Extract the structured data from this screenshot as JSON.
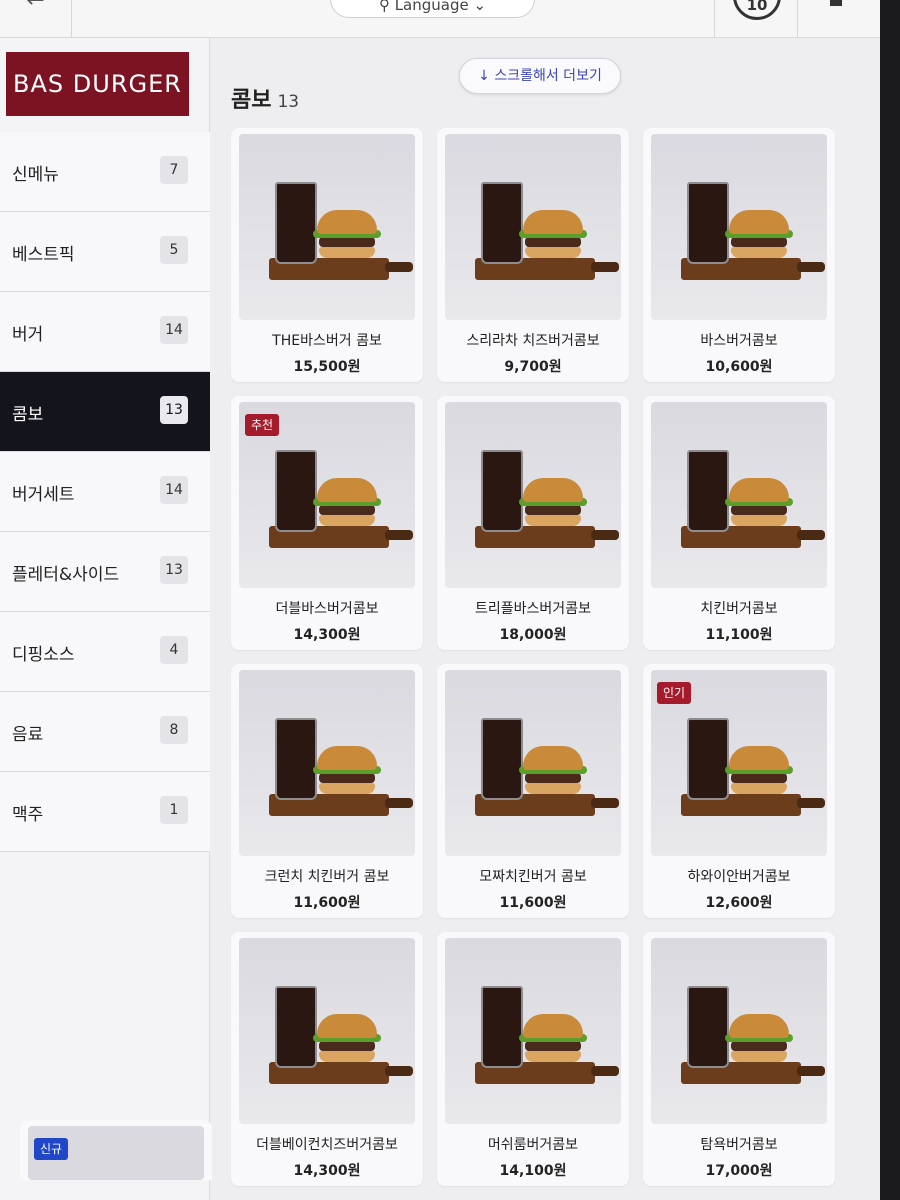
{
  "topbar": {
    "back_label": "←",
    "language_label": "⚲ Language ⌄",
    "timer_value": "10"
  },
  "brand": {
    "logo_text": "BAS DURGER",
    "color": "#7b1322"
  },
  "sidebar": {
    "categories": [
      {
        "label": "신메뉴",
        "count": "7"
      },
      {
        "label": "베스트픽",
        "count": "5"
      },
      {
        "label": "버거",
        "count": "14"
      },
      {
        "label": "콤보",
        "count": "13"
      },
      {
        "label": "버거세트",
        "count": "14"
      },
      {
        "label": "플레터&사이드",
        "count": "13"
      },
      {
        "label": "디핑소스",
        "count": "4"
      },
      {
        "label": "음료",
        "count": "8"
      },
      {
        "label": "맥주",
        "count": "1"
      }
    ],
    "active_index": 3
  },
  "main": {
    "scroll_hint": "↓ 스크롤해서 더보기",
    "section_title": "콤보",
    "section_count": "13",
    "items": [
      {
        "name": "THE바스버거 콤보",
        "price": "15,500원",
        "badge": ""
      },
      {
        "name": "스리라차 치즈버거콤보",
        "price": "9,700원",
        "badge": ""
      },
      {
        "name": "바스버거콤보",
        "price": "10,600원",
        "badge": ""
      },
      {
        "name": "더블바스버거콤보",
        "price": "14,300원",
        "badge": "추천"
      },
      {
        "name": "트리플바스버거콤보",
        "price": "18,000원",
        "badge": ""
      },
      {
        "name": "치킨버거콤보",
        "price": "11,100원",
        "badge": ""
      },
      {
        "name": "크런치 치킨버거 콤보",
        "price": "11,600원",
        "badge": ""
      },
      {
        "name": "모짜치킨버거 콤보",
        "price": "11,600원",
        "badge": ""
      },
      {
        "name": "하와이안버거콤보",
        "price": "12,600원",
        "badge": "인기"
      },
      {
        "name": "더블베이컨치즈버거콤보",
        "price": "14,300원",
        "badge": ""
      },
      {
        "name": "머쉬룸버거콤보",
        "price": "14,100원",
        "badge": ""
      },
      {
        "name": "탐욕버거콤보",
        "price": "17,000원",
        "badge": ""
      }
    ],
    "partial_badge": "신규"
  },
  "colors": {
    "active_category_bg": "#14141c",
    "badge_red": "#a51b2c",
    "badge_blue": "#1f47c7",
    "scroll_hint_text": "#3d47b4"
  }
}
